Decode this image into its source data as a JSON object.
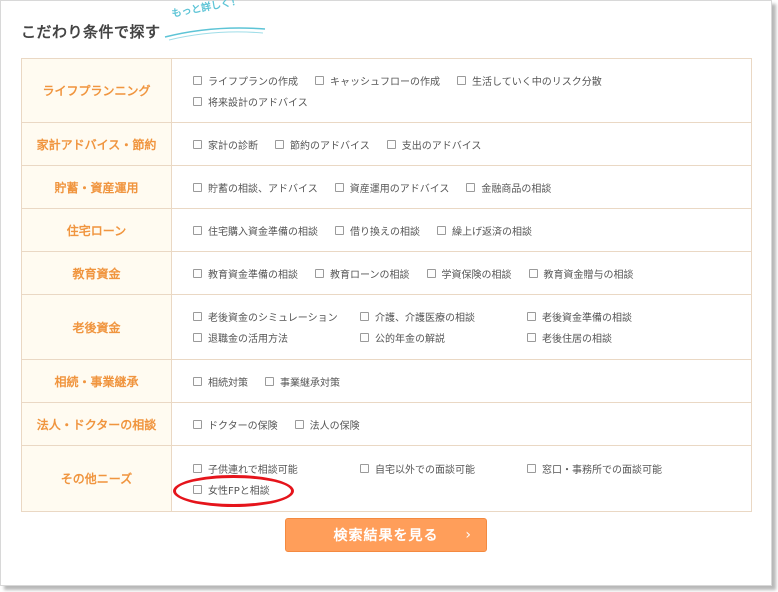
{
  "heading": {
    "title": "こだわり条件で探す",
    "tag": "もっと詳しく！"
  },
  "criteria": {
    "rows": [
      {
        "category": "ライフプランニング",
        "options": [
          "ライフプランの作成",
          "キャッシュフローの作成",
          "生活していく中のリスク分散",
          "将来設計のアドバイス"
        ]
      },
      {
        "category": "家計アドバイス・節約",
        "options": [
          "家計の診断",
          "節約のアドバイス",
          "支出のアドバイス"
        ]
      },
      {
        "category": "貯蓄・資産運用",
        "options": [
          "貯蓄の相談、アドバイス",
          "資産運用のアドバイス",
          "金融商品の相談"
        ]
      },
      {
        "category": "住宅ローン",
        "options": [
          "住宅購入資金準備の相談",
          "借り換えの相談",
          "繰上げ返済の相談"
        ]
      },
      {
        "category": "教育資金",
        "options": [
          "教育資金準備の相談",
          "教育ローンの相談",
          "学資保険の相談",
          "教育資金贈与の相談"
        ]
      },
      {
        "category": "老後資金",
        "options": [
          "老後資金のシミュレーション",
          "介護、介護医療の相談",
          "老後資金準備の相談",
          "退職金の活用方法",
          "公的年金の解説",
          "老後住居の相談"
        ]
      },
      {
        "category": "相続・事業継承",
        "options": [
          "相続対策",
          "事業継承対策"
        ]
      },
      {
        "category": "法人・ドクターの相談",
        "options": [
          "ドクターの保険",
          "法人の保険"
        ]
      },
      {
        "category": "その他ニーズ",
        "options": [
          "子供連れで相談可能",
          "自宅以外での面談可能",
          "窓口・事務所での面談可能",
          "女性FPと相談"
        ]
      }
    ]
  },
  "search_button": {
    "label": "検索結果を見る",
    "arrow": "›"
  },
  "colors": {
    "accent": "#f0953f",
    "button": "#ff9e5a",
    "highlight": "#e5141b",
    "tag": "#5dc4d6"
  }
}
